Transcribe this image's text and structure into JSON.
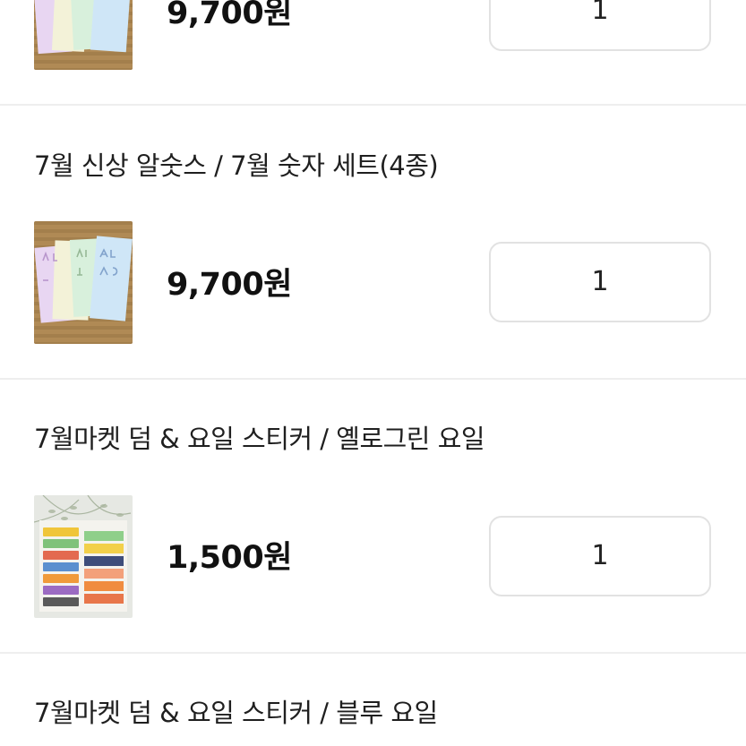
{
  "items": [
    {
      "title": "",
      "price": "9,700원",
      "quantity": "1",
      "thumbnail_icon": "alphabet-sticker-sheets-image"
    },
    {
      "title": "7월 신상 알숫스 / 7월 숫자 세트(4종)",
      "price": "9,700원",
      "quantity": "1",
      "thumbnail_icon": "alphabet-sticker-sheets-image"
    },
    {
      "title": "7월마켓 덤 & 요일 스티커 / 옐로그린 요일",
      "price": "1,500원",
      "quantity": "1",
      "thumbnail_icon": "weekday-sticker-sheet-image"
    },
    {
      "title": "7월마켓 덤 & 요일 스티커 / 블루 요일",
      "price": "",
      "quantity": "",
      "thumbnail_icon": ""
    }
  ],
  "colors": {
    "divider": "#eeeeee",
    "quantity_border": "#e2e2e2",
    "wood": "#b08a55"
  }
}
